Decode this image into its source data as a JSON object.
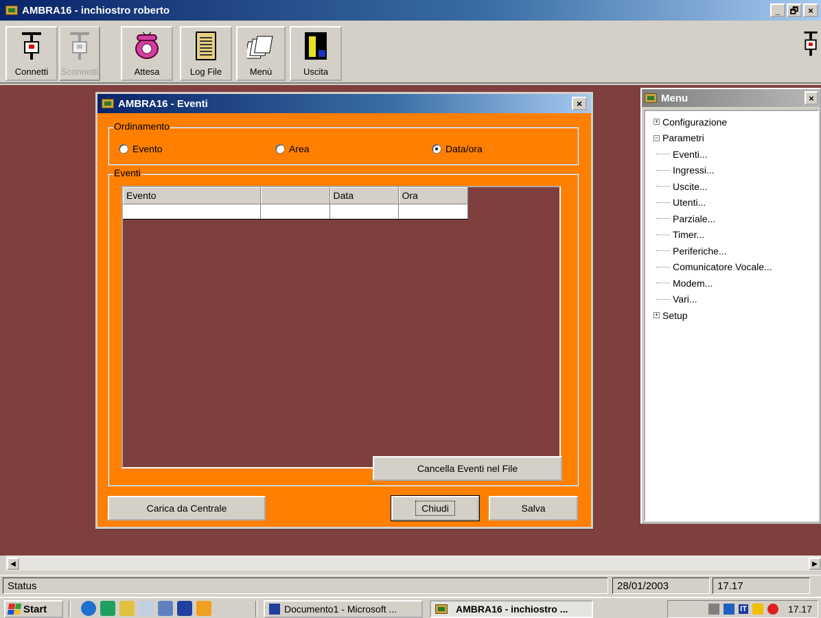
{
  "window": {
    "title": "AMBRA16 - inchiostro roberto",
    "buttons": [
      "_",
      "🗗",
      "×"
    ]
  },
  "toolbar": {
    "connetti": "Connetti",
    "sconnetti": "Sconnetti",
    "attesa": "Attesa",
    "log_file": "Log File",
    "menu": "Menù",
    "uscita": "Uscita"
  },
  "dialog": {
    "title": "AMBRA16 - Eventi",
    "close": "×",
    "ordinamento": {
      "label": "Ordinamento",
      "options": [
        "Evento",
        "Area",
        "Data/ora"
      ],
      "selected": "Data/ora"
    },
    "eventi": {
      "label": "Eventi",
      "columns": [
        "Evento",
        "",
        "Data",
        "Ora"
      ]
    },
    "buttons": {
      "cancella": "Cancella Eventi nel File",
      "carica": "Carica da Centrale",
      "chiudi": "Chiudi",
      "salva": "Salva"
    }
  },
  "menu_panel": {
    "title": "Menu",
    "close": "×",
    "tree": {
      "configurazione": "Configurazione",
      "parametri": "Parametri",
      "children": [
        "Eventi...",
        "Ingressi...",
        "Uscite...",
        "Utenti...",
        "Parziale...",
        "Timer...",
        "Periferiche...",
        "Comunicatore Vocale...",
        "Modem...",
        "Vari..."
      ],
      "setup": "Setup"
    }
  },
  "statusbar": {
    "status": "Status",
    "date": "28/01/2003",
    "time": "17.17"
  },
  "taskbar": {
    "start": "Start",
    "tasks": [
      "Documento1 - Microsoft ...",
      "AMBRA16 - inchiostro ..."
    ],
    "tray_lang": "IT",
    "clock": "17.17"
  },
  "colors": {
    "dialog_bg": "#ff7f00",
    "desktop_bg": "#7f3f3f",
    "titlebar": "#0a246a"
  }
}
